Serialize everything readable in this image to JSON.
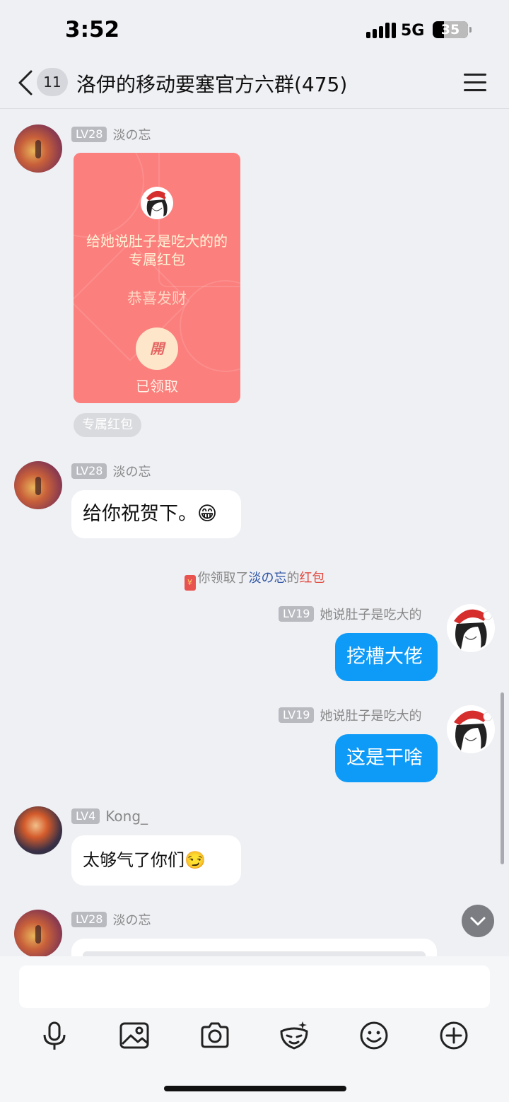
{
  "status_bar": {
    "time": "3:52",
    "network": "5G",
    "battery": "35"
  },
  "header": {
    "back_label": "",
    "unread_count": "11",
    "title": "洛伊的移动要塞官方六群(475)"
  },
  "messages": [
    {
      "level": "LV28",
      "sender": "淡の忘",
      "type": "red_packet",
      "red_packet": {
        "title": "给她说肚子是吃大的的专属红包",
        "wish": "恭喜发财",
        "open_label": "開",
        "status": "已领取",
        "tag": "专属红包"
      }
    },
    {
      "level": "LV28",
      "sender": "淡の忘",
      "text": "给你祝贺下。😁"
    },
    {
      "level": "LV19",
      "sender": "她说肚子是吃大的",
      "text": "挖槽大佬"
    },
    {
      "level": "LV19",
      "sender": "她说肚子是吃大的",
      "text": "这是干啥"
    },
    {
      "level": "LV4",
      "sender": "Kong_",
      "text": "太够气了你们😏"
    },
    {
      "level": "LV28",
      "sender": "淡の忘",
      "text": ""
    }
  ],
  "notice": {
    "prefix": "你领取了",
    "name": "淡の忘",
    "middle": "的",
    "suffix": "红包"
  },
  "input": {
    "placeholder": ""
  },
  "toolbar": [
    "microphone-icon",
    "image-icon",
    "camera-icon",
    "sticker-icon",
    "emoji-icon",
    "plus-icon"
  ],
  "colors": {
    "outgoing_bubble": "#0e9bf7",
    "red_packet": "#fb7f7d",
    "background": "#eff0f4"
  }
}
